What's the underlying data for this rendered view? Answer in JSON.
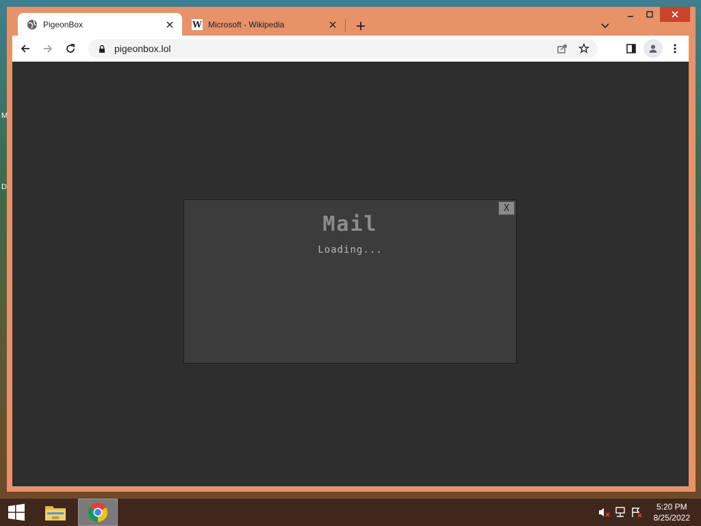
{
  "desktop": {
    "labels": [
      "M",
      "D"
    ]
  },
  "browser": {
    "tabs": [
      {
        "title": "PigeonBox",
        "favicon": "globe-icon",
        "active": true
      },
      {
        "title": "Microsoft - Wikipedia",
        "favicon": "wikipedia-w-icon",
        "active": false
      }
    ],
    "address_bar": {
      "url": "pigeonbox.lol",
      "secure_icon": "lock-icon"
    },
    "colors": {
      "frame": "#e8926a",
      "page_background": "#2e2e2e",
      "modal_background": "#3c3c3c"
    }
  },
  "page": {
    "modal": {
      "title": "Mail",
      "status": "Loading...",
      "close_label": "X"
    }
  },
  "taskbar": {
    "apps": [
      "file-explorer-icon",
      "chrome-icon"
    ],
    "tray_icons": [
      "speaker-muted-icon",
      "network-icon",
      "action-center-flag-icon"
    ],
    "time": "5:20 PM",
    "date": "8/25/2022"
  }
}
